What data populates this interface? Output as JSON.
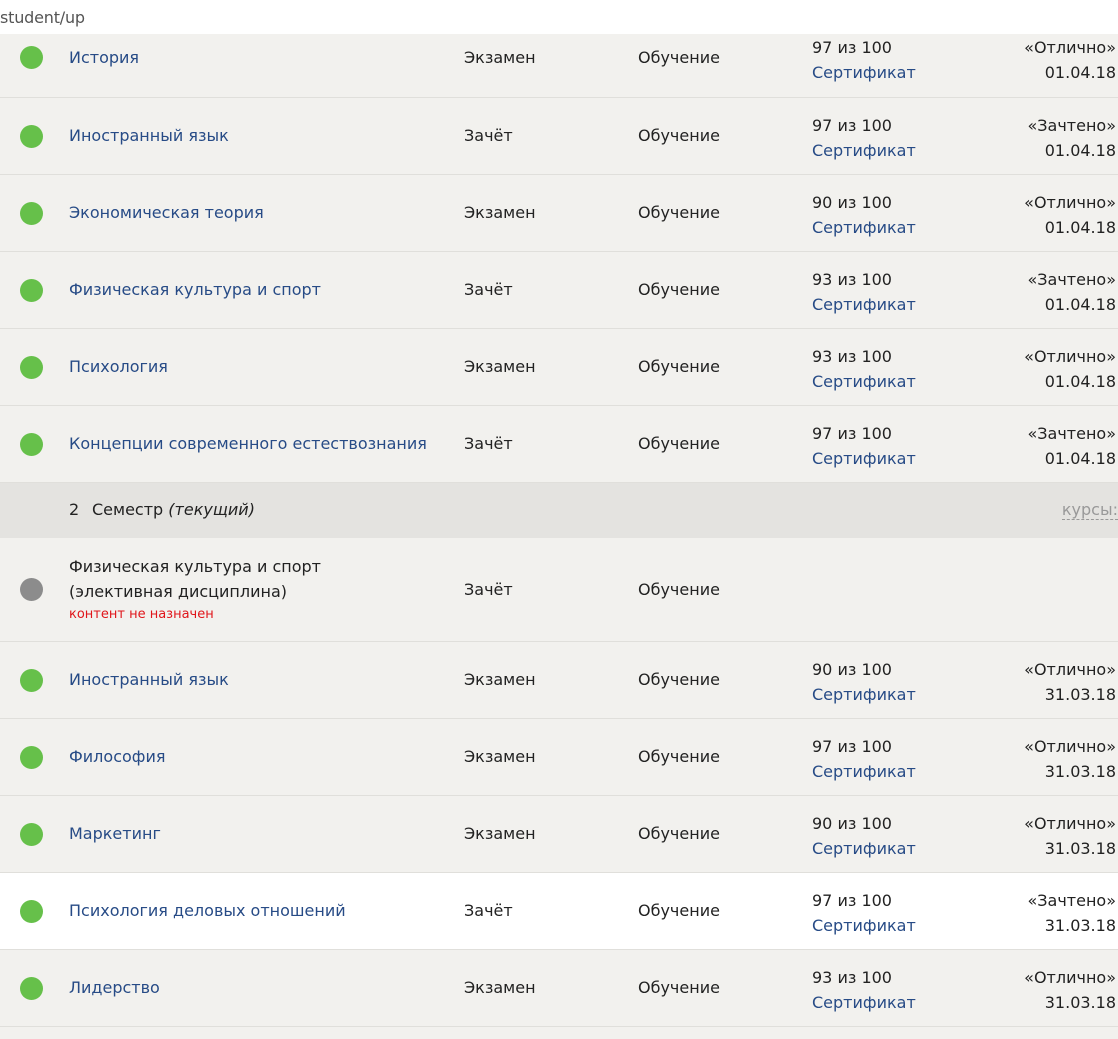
{
  "url": "student/up",
  "rows_sem1": [
    {
      "name": "История",
      "type": "Экзамен",
      "state": "Обучение",
      "score": "97 из 100",
      "cert": "Сертификат",
      "grade": "«Отлично»",
      "date": "01.04.18"
    },
    {
      "name": "Иностранный язык",
      "type": "Зачёт",
      "state": "Обучение",
      "score": "97 из 100",
      "cert": "Сертификат",
      "grade": "«Зачтено»",
      "date": "01.04.18"
    },
    {
      "name": "Экономическая теория",
      "type": "Экзамен",
      "state": "Обучение",
      "score": "90 из 100",
      "cert": "Сертификат",
      "grade": "«Отлично»",
      "date": "01.04.18"
    },
    {
      "name": "Физическая культура и спорт",
      "type": "Зачёт",
      "state": "Обучение",
      "score": "93 из 100",
      "cert": "Сертификат",
      "grade": "«Зачтено»",
      "date": "01.04.18"
    },
    {
      "name": "Психология",
      "type": "Экзамен",
      "state": "Обучение",
      "score": "93 из 100",
      "cert": "Сертификат",
      "grade": "«Отлично»",
      "date": "01.04.18"
    },
    {
      "name": "Концепции современного естествознания",
      "type": "Зачёт",
      "state": "Обучение",
      "score": "97 из 100",
      "cert": "Сертификат",
      "grade": "«Зачтено»",
      "date": "01.04.18"
    }
  ],
  "semester": {
    "number": "2",
    "label": "Семестр",
    "current": "(текущий)",
    "courses_link": "курсы:"
  },
  "pending_row": {
    "name": "Физическая культура и спорт (элективная дисциплина)",
    "warning": "контент не назначен",
    "type": "Зачёт",
    "state": "Обучение"
  },
  "rows_sem2": [
    {
      "name": "Иностранный язык",
      "type": "Экзамен",
      "state": "Обучение",
      "score": "90 из 100",
      "cert": "Сертификат",
      "grade": "«Отлично»",
      "date": "31.03.18"
    },
    {
      "name": "Философия",
      "type": "Экзамен",
      "state": "Обучение",
      "score": "97 из 100",
      "cert": "Сертификат",
      "grade": "«Отлично»",
      "date": "31.03.18"
    },
    {
      "name": "Маркетинг",
      "type": "Экзамен",
      "state": "Обучение",
      "score": "90 из 100",
      "cert": "Сертификат",
      "grade": "«Отлично»",
      "date": "31.03.18"
    },
    {
      "name": "Психология деловых отношений",
      "type": "Зачёт",
      "state": "Обучение",
      "score": "97 из 100",
      "cert": "Сертификат",
      "grade": "«Зачтено»",
      "date": "31.03.18"
    },
    {
      "name": "Лидерство",
      "type": "Экзамен",
      "state": "Обучение",
      "score": "93 из 100",
      "cert": "Сертификат",
      "grade": "«Отлично»",
      "date": "31.03.18"
    }
  ],
  "colors": {
    "status_done": "#66c04a",
    "status_pending": "#8c8c8c",
    "link": "#274b86",
    "warning": "#e0151a",
    "row_bg": "#f2f1ee",
    "semester_bg": "#e4e3e0"
  }
}
